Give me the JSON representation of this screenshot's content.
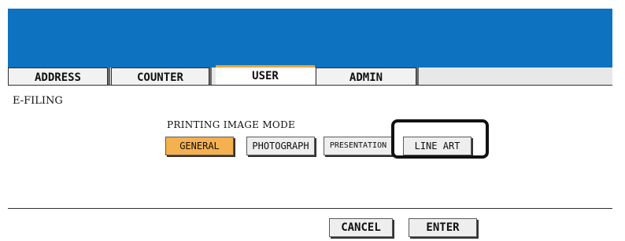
{
  "tabs": [
    {
      "label": "ADDRESS"
    },
    {
      "label": "COUNTER"
    },
    {
      "label": "USER"
    },
    {
      "label": "ADMIN"
    }
  ],
  "section": {
    "title": "E-FILING"
  },
  "printing_mode": {
    "label": "PRINTING IMAGE MODE",
    "options": [
      {
        "label": "GENERAL"
      },
      {
        "label": "PHOTOGRAPH"
      },
      {
        "label": "PRESENTATION"
      },
      {
        "label": "LINE ART"
      }
    ],
    "selected": "GENERAL"
  },
  "actions": {
    "cancel_label": "CANCEL",
    "enter_label": "ENTER"
  },
  "colors": {
    "header": "#0d72bf",
    "accent": "#f5b050",
    "active_tab_border": "#e8a640"
  }
}
